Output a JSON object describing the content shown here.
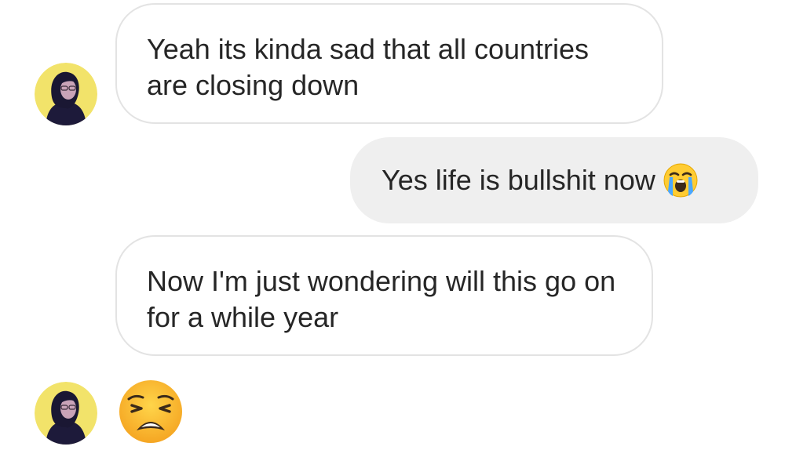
{
  "conversation": {
    "messages": [
      {
        "direction": "incoming",
        "text": "Yeah its kinda sad that all countries are closing down"
      },
      {
        "direction": "outgoing",
        "text": "Yes life is bullshit now",
        "emoji": "loudly-crying-face"
      },
      {
        "direction": "incoming",
        "text": "Now I'm just wondering will this go on for a while year"
      },
      {
        "direction": "incoming",
        "emoji": "weary-face"
      }
    ]
  },
  "colors": {
    "incoming_bubble_border": "#e3e3e3",
    "outgoing_bubble_bg": "#efefef",
    "text": "#262626",
    "avatar_bg": "#f2e36a"
  }
}
